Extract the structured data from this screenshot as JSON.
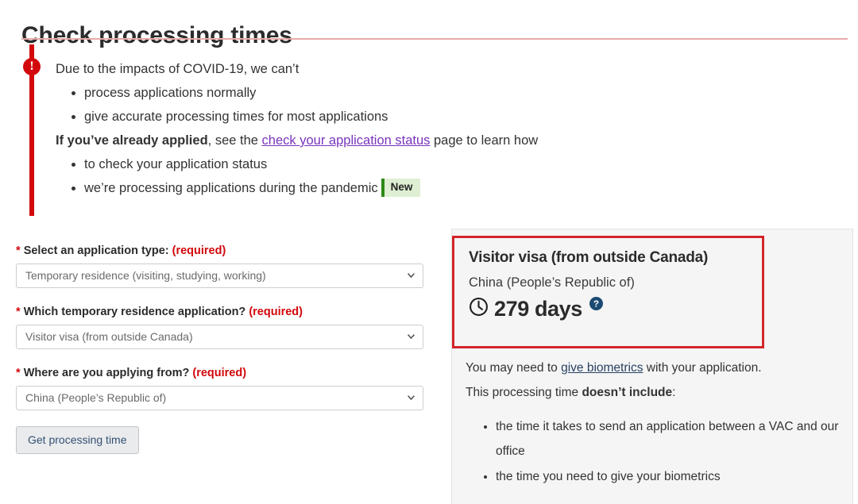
{
  "page": {
    "title": "Check processing times"
  },
  "alert": {
    "icon": "exclamation-circle-icon",
    "intro": "Due to the impacts of COVID-19, we can’t",
    "bullets_top": [
      "process applications normally",
      "give accurate processing times for most applications"
    ],
    "applied_bold": "If you’ve already applied",
    "applied_mid": ", see the ",
    "applied_link": "check your application status",
    "applied_tail": " page to learn how",
    "bullets_bottom": [
      "to check your application status",
      "we’re processing applications during the pandemic"
    ],
    "badge": "New",
    "badge_color": "#2d8a17",
    "badge_background": "#deefd3",
    "accent_color": "#d3080c",
    "link_color": "#7834bc"
  },
  "form": {
    "required_star": "*",
    "required_text": "(required)",
    "fields": [
      {
        "label": "Select an application type:",
        "value": "Temporary residence (visiting, studying, working)"
      },
      {
        "label": "Which temporary residence application?",
        "value": "Visitor visa (from outside Canada)"
      },
      {
        "label": "Where are you applying from?",
        "value": "China (People’s Republic of)"
      }
    ],
    "submit_label": "Get processing time"
  },
  "result": {
    "title": "Visitor visa (from outside Canada)",
    "country": "China (People’s Republic of)",
    "time_value": "279 days",
    "clock_icon": "clock-icon",
    "help_icon": "help-question-icon",
    "box_border_color": "#d3252b",
    "help_icon_color": "#1b4a72",
    "notes_line1_pre": "You may need to ",
    "notes_line1_link": "give biometrics",
    "notes_line1_post": " with your application.",
    "notes_line2_pre": "This processing time ",
    "notes_line2_bold": "doesn’t include",
    "notes_line2_post": ":",
    "notes_bullets": [
      "the time it takes to send an application between a VAC and our office",
      "the time you need to give your biometrics"
    ]
  }
}
